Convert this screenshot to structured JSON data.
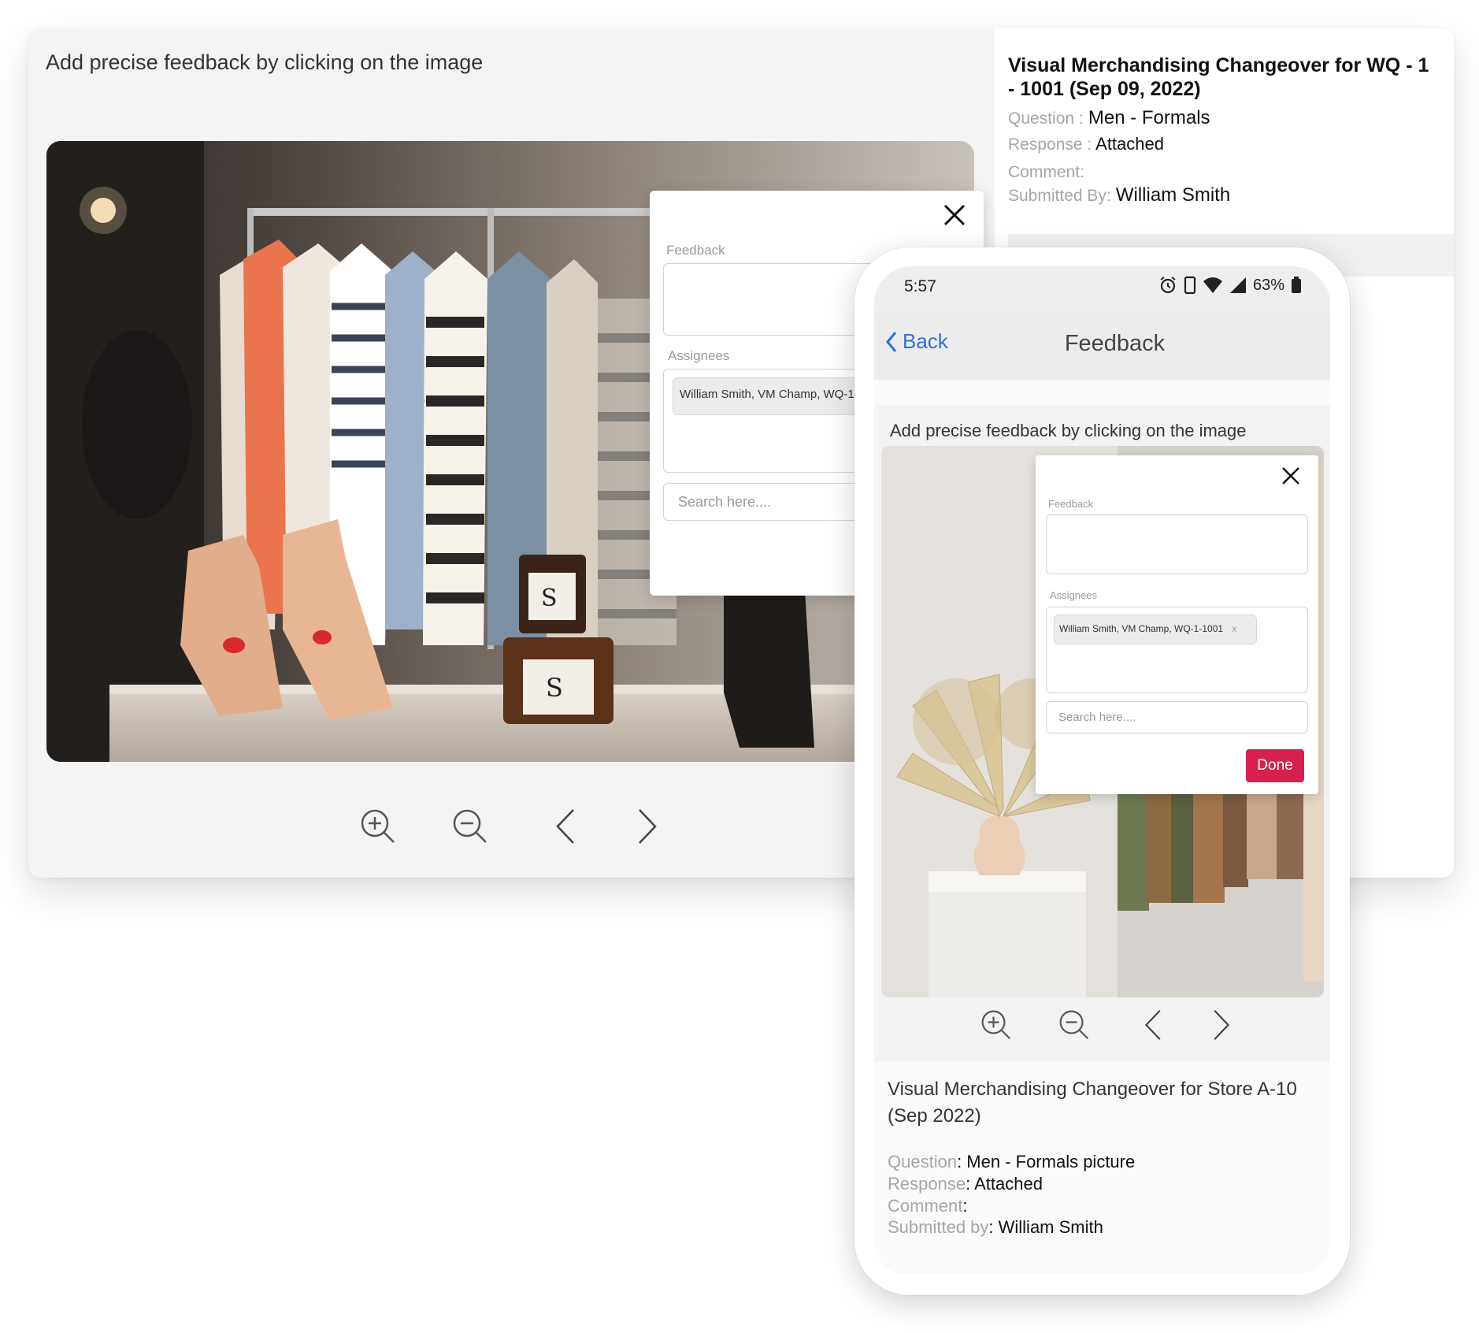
{
  "desktop": {
    "heading": "Add precise feedback by clicking on the image",
    "popup": {
      "feedback_label": "Feedback",
      "assignees_label": "Assignees",
      "assignee_chip": "William Smith, VM Champ, WQ-1-1001",
      "search_placeholder": "Search here...."
    },
    "details": {
      "title": "Visual Merchandising Changeover for WQ - 1 - 1001 (Sep 09, 2022)",
      "question_key": "Question :",
      "question_value": "Men - Formals",
      "response_key": "Response :",
      "response_value": "Attached",
      "comment_key": "Comment:",
      "comment_value": "",
      "submitted_key": "Submitted By:",
      "submitted_value": "William Smith"
    },
    "toolbar": [
      "zoom-in",
      "zoom-out",
      "previous",
      "next"
    ]
  },
  "phone": {
    "status": {
      "time": "5:57",
      "battery": "63%"
    },
    "nav": {
      "back_label": "Back",
      "title": "Feedback"
    },
    "heading": "Add precise feedback by clicking on the image",
    "popup": {
      "feedback_label": "Feedback",
      "assignees_label": "Assignees",
      "assignee_chip": "William Smith, VM Champ, WQ-1-1001",
      "chip_remove": "x",
      "search_placeholder": "Search here....",
      "done_label": "Done"
    },
    "details": {
      "title": "Visual Merchandising Changeover for Store A-10 (Sep 2022)",
      "question_key": "Question",
      "question_value": ": Men -  Formals picture",
      "response_key": "Response",
      "response_value": ": Attached",
      "comment_key": "Comment",
      "comment_value": ":",
      "submitted_key": "Submitted by",
      "submitted_value": ": William Smith"
    }
  },
  "colors": {
    "accent_link": "#2f6fde",
    "done_button": "#d6204f",
    "card_bg": "#f4f4f4",
    "label_grey": "#a6a6a6"
  }
}
